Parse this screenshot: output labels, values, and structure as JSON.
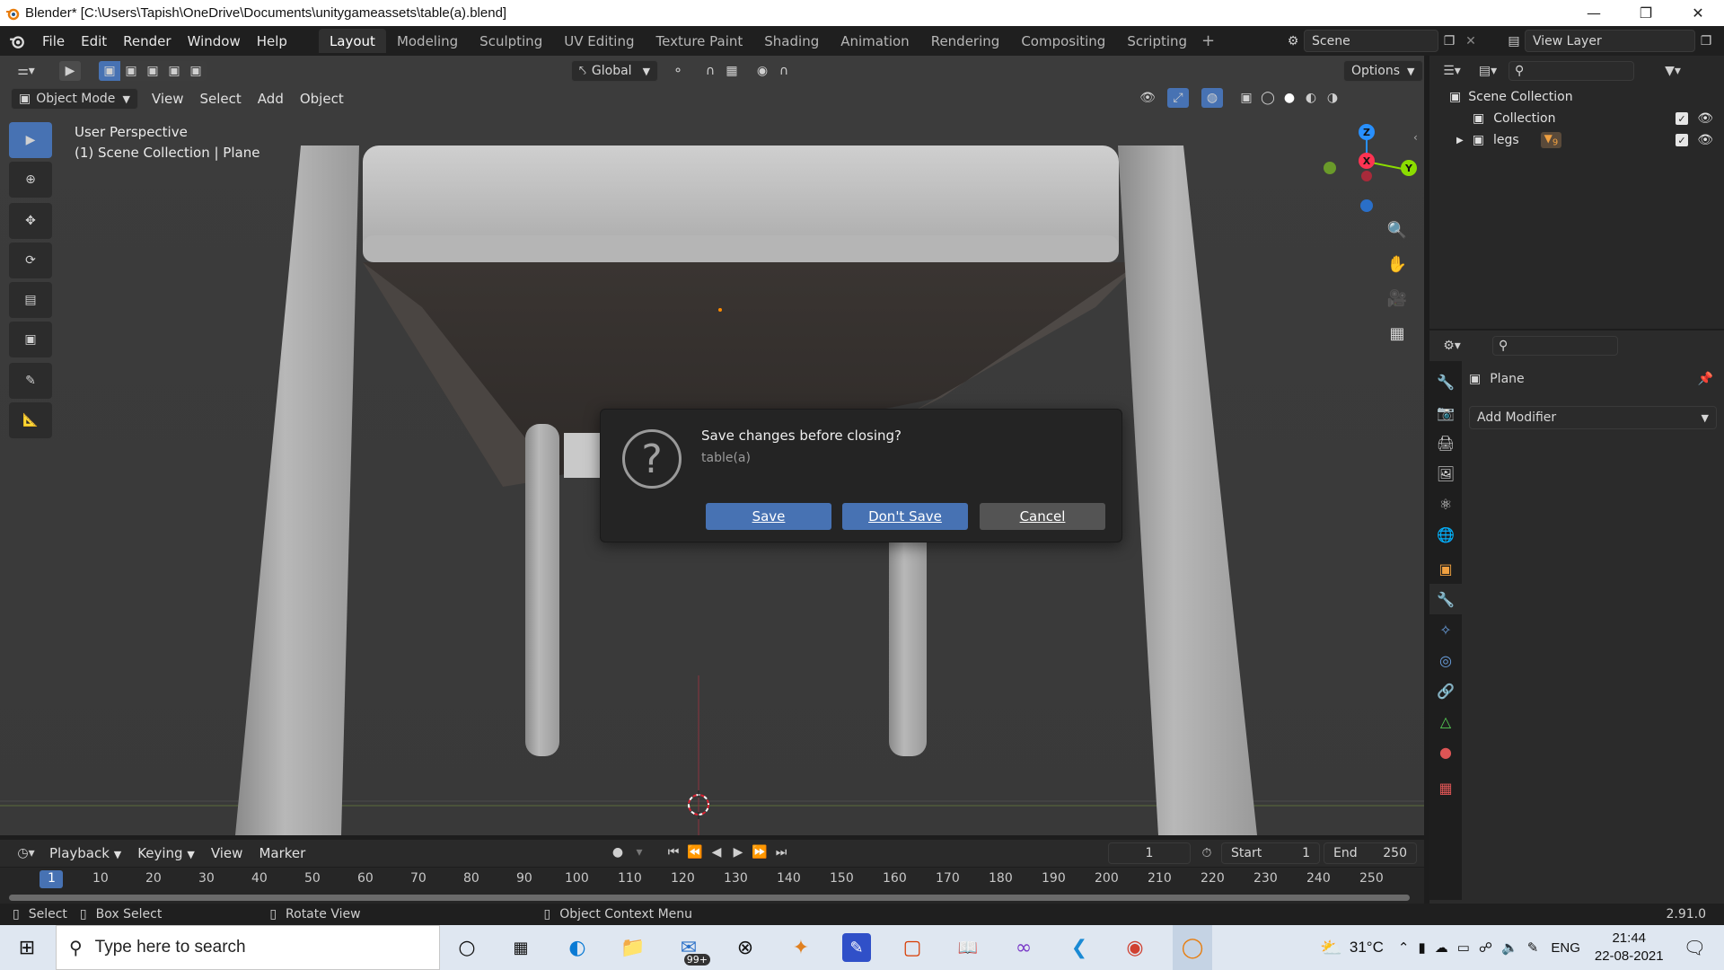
{
  "window": {
    "title": "Blender* [C:\\Users\\Tapish\\OneDrive\\Documents\\unitygameassets\\table(a).blend]",
    "controls": [
      "minimize",
      "restore",
      "close"
    ]
  },
  "menubar": {
    "menus": [
      "File",
      "Edit",
      "Render",
      "Window",
      "Help"
    ],
    "workspaces": [
      "Layout",
      "Modeling",
      "Sculpting",
      "UV Editing",
      "Texture Paint",
      "Shading",
      "Animation",
      "Rendering",
      "Compositing",
      "Scripting"
    ],
    "active_workspace": "Layout",
    "add_workspace": "+",
    "scene_label": "Scene",
    "view_layer_label": "View Layer"
  },
  "viewport_header": {
    "transform_orientation": "Global",
    "options": "Options",
    "mode": "Object Mode",
    "menus": [
      "View",
      "Select",
      "Add",
      "Object"
    ]
  },
  "viewport": {
    "perspective": "User Perspective",
    "collection_info": "(1) Scene Collection | Plane",
    "gizmo": {
      "z": "Z",
      "y": "Y",
      "x": "X"
    }
  },
  "dialog": {
    "message": "Save changes before closing?",
    "file_name": "table(a)",
    "icon": "?",
    "buttons": {
      "save": "Save",
      "dont_save": "Don't Save",
      "cancel": "Cancel"
    }
  },
  "timeline": {
    "menus": [
      "Playback",
      "Keying",
      "View",
      "Marker"
    ],
    "current_frame": "1",
    "start_label": "Start",
    "start_value": "1",
    "end_label": "End",
    "end_value": "250",
    "ruler": [
      "1",
      "10",
      "20",
      "30",
      "40",
      "50",
      "60",
      "70",
      "80",
      "90",
      "100",
      "110",
      "120",
      "130",
      "140",
      "150",
      "160",
      "170",
      "180",
      "190",
      "200",
      "210",
      "220",
      "230",
      "240",
      "250"
    ]
  },
  "statusbar": {
    "select": "Select",
    "box_select": "Box Select",
    "rotate_view": "Rotate View",
    "context_menu": "Object Context Menu",
    "version": "2.91.0"
  },
  "outliner": {
    "root": "Scene Collection",
    "items": [
      {
        "label": "Collection"
      },
      {
        "label": "legs",
        "badge": "9"
      }
    ]
  },
  "properties": {
    "object_name": "Plane",
    "add_modifier": "Add Modifier"
  },
  "taskbar": {
    "search_placeholder": "Type here to search",
    "mail_badge": "99+",
    "temperature": "31°C",
    "language": "ENG",
    "time": "21:44",
    "date": "22-08-2021"
  },
  "colors": {
    "accent": "#4772b3",
    "axis_x": "#ff3352",
    "axis_y": "#8bdc00",
    "axis_z": "#2890ff"
  }
}
